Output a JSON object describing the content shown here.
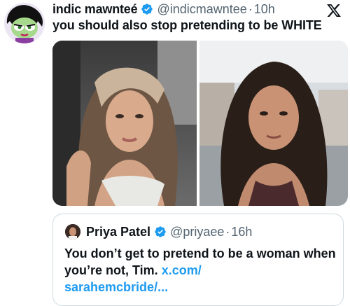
{
  "tweet": {
    "display_name": "indic mawnteé",
    "handle": "@indicmawntee",
    "separator": "·",
    "time": "10h",
    "text": "you should also stop pretending to be WHITE"
  },
  "quoted_tweet": {
    "display_name": "Priya Patel",
    "handle": "@priyaee",
    "separator": "·",
    "time": "16h",
    "text": "You don’t get to pretend to be a woman when you’re not, Tim. ",
    "link_line1": "x.com/",
    "link_line2": "sarahemcbride/..."
  },
  "icons": {
    "verified": "verified-badge-icon",
    "platform": "x-logo-icon"
  },
  "colors": {
    "accent": "#1d9bf0",
    "secondary_text": "#536471",
    "border": "#cfd9de"
  }
}
